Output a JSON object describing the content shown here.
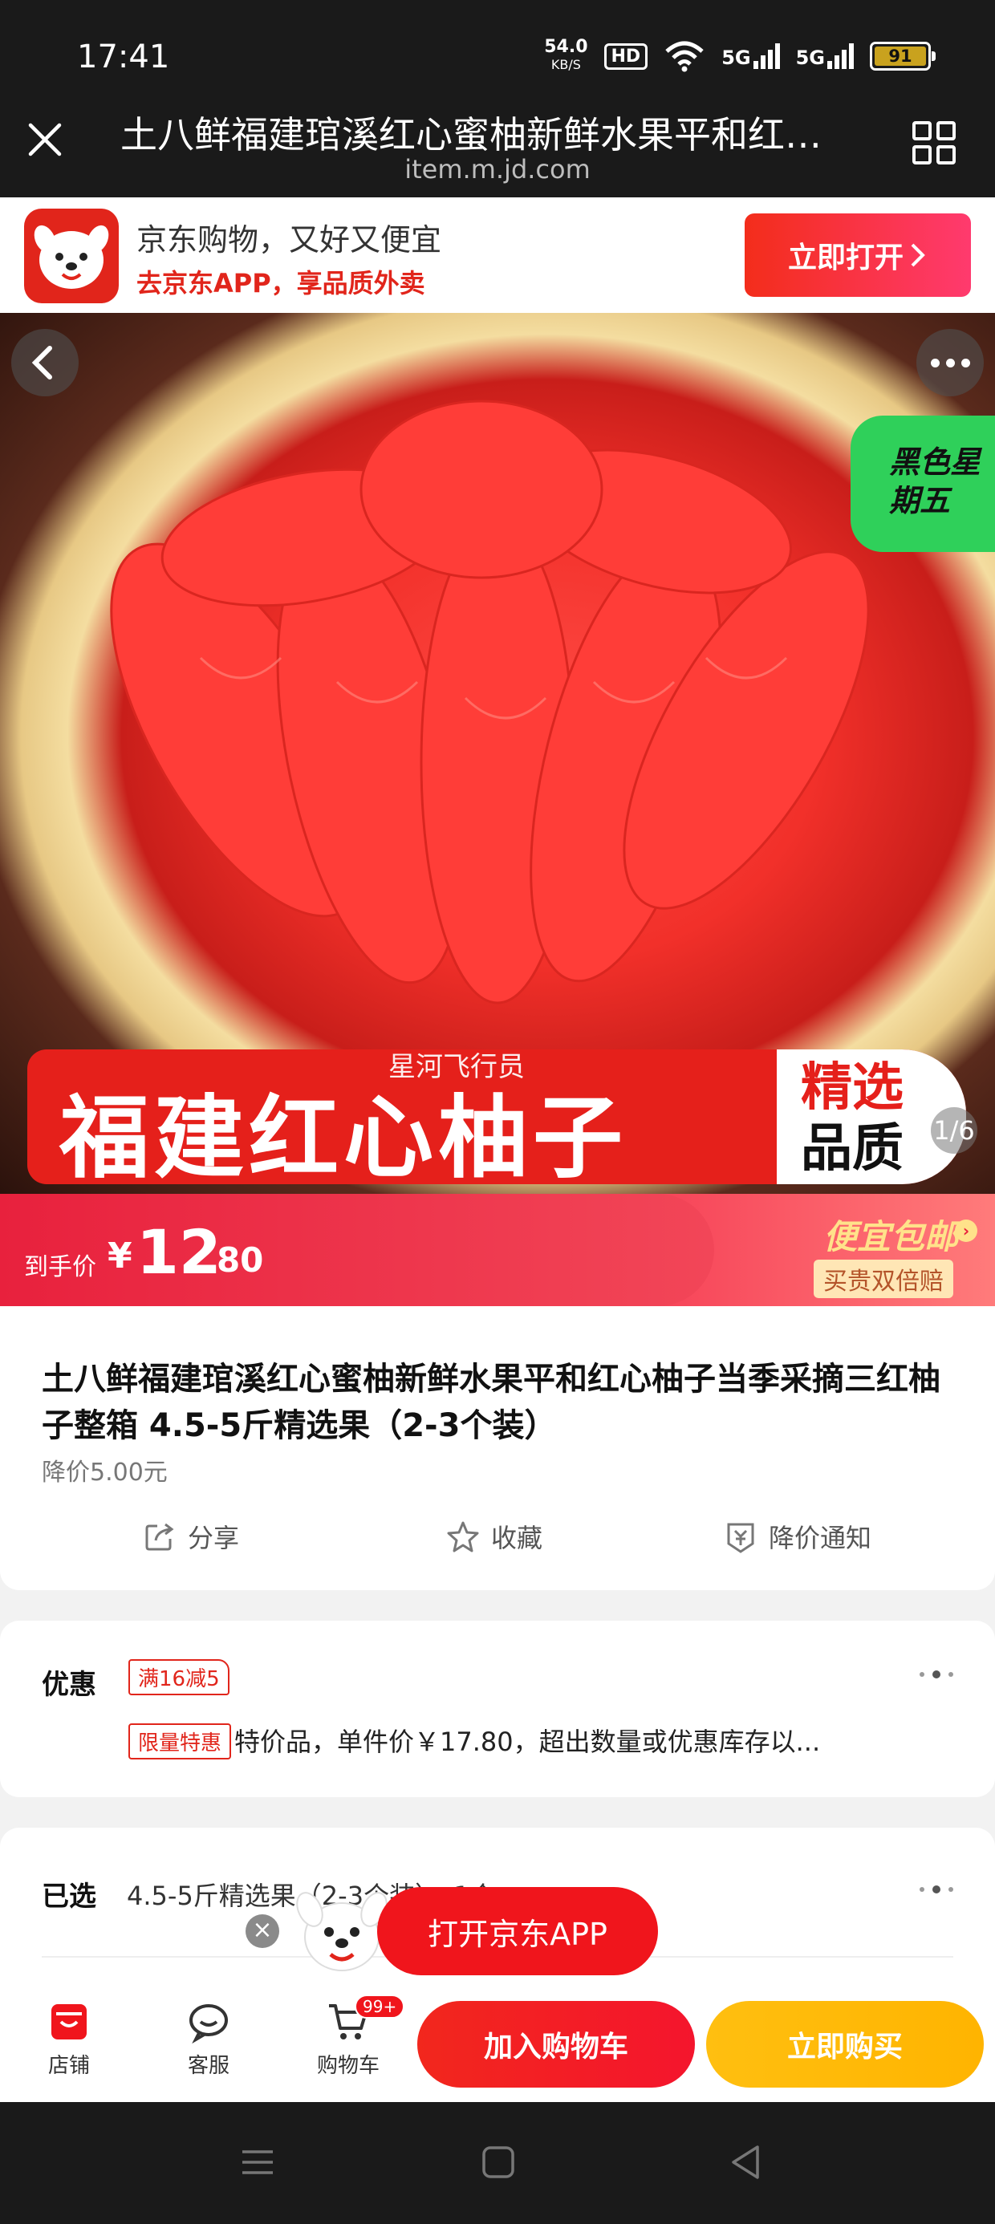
{
  "status_bar": {
    "time": "17:41",
    "net_speed_value": "54.0",
    "net_speed_unit": "KB/S",
    "hd_label": "HD",
    "sim1_label": "5G",
    "sim2_label": "5G",
    "battery_level": "91"
  },
  "browser": {
    "title": "土八鲜福建琯溪红心蜜柚新鲜水果平和红…",
    "url": "item.m.jd.com",
    "close_icon": "close-icon",
    "menu_icon": "grid-icon"
  },
  "app_banner": {
    "line1": "京东购物，又好又便宜",
    "line2": "去京东APP，享品质外卖",
    "open_button": "立即打开"
  },
  "hero": {
    "badge": "黑色星期五",
    "banner_text": "福建红心柚子",
    "banner_right_1": "精选",
    "banner_right_2": "品质",
    "watermark": "星河飞行员",
    "counter": "1/6"
  },
  "price": {
    "label": "到手价",
    "currency": "¥",
    "integer": "12",
    "decimal": ".80",
    "promo_main": "便宜包邮",
    "promo_sub": "买贵双倍赔"
  },
  "product": {
    "title": "土八鲜福建琯溪红心蜜柚新鲜水果平和红心柚子当季采摘三红柚子整箱 4.5-5斤精选果（2-3个装）",
    "price_drop": "降价5.00元",
    "actions": {
      "share": "分享",
      "favorite": "收藏",
      "price_alert": "降价通知"
    }
  },
  "promotion": {
    "label": "优惠",
    "tag_discount": "满16减5",
    "tag_limited": "限量特惠",
    "description": "特价品，单件价￥17.80，超出数量或优惠库存以..."
  },
  "selected": {
    "label": "已选",
    "value": "4.5-5斤精选果（2-3个装），1个"
  },
  "floating": {
    "open_app": "打开京东APP",
    "close_symbol": "×"
  },
  "bottom_bar": {
    "store": "店铺",
    "service": "客服",
    "cart": "购物车",
    "cart_badge": "99+",
    "add_to_cart": "加入购物车",
    "buy_now": "立即购买"
  },
  "colors": {
    "brand_red": "#e1251b",
    "buy_yellow": "#ffb400",
    "dark_bar": "#1a1a1a"
  }
}
